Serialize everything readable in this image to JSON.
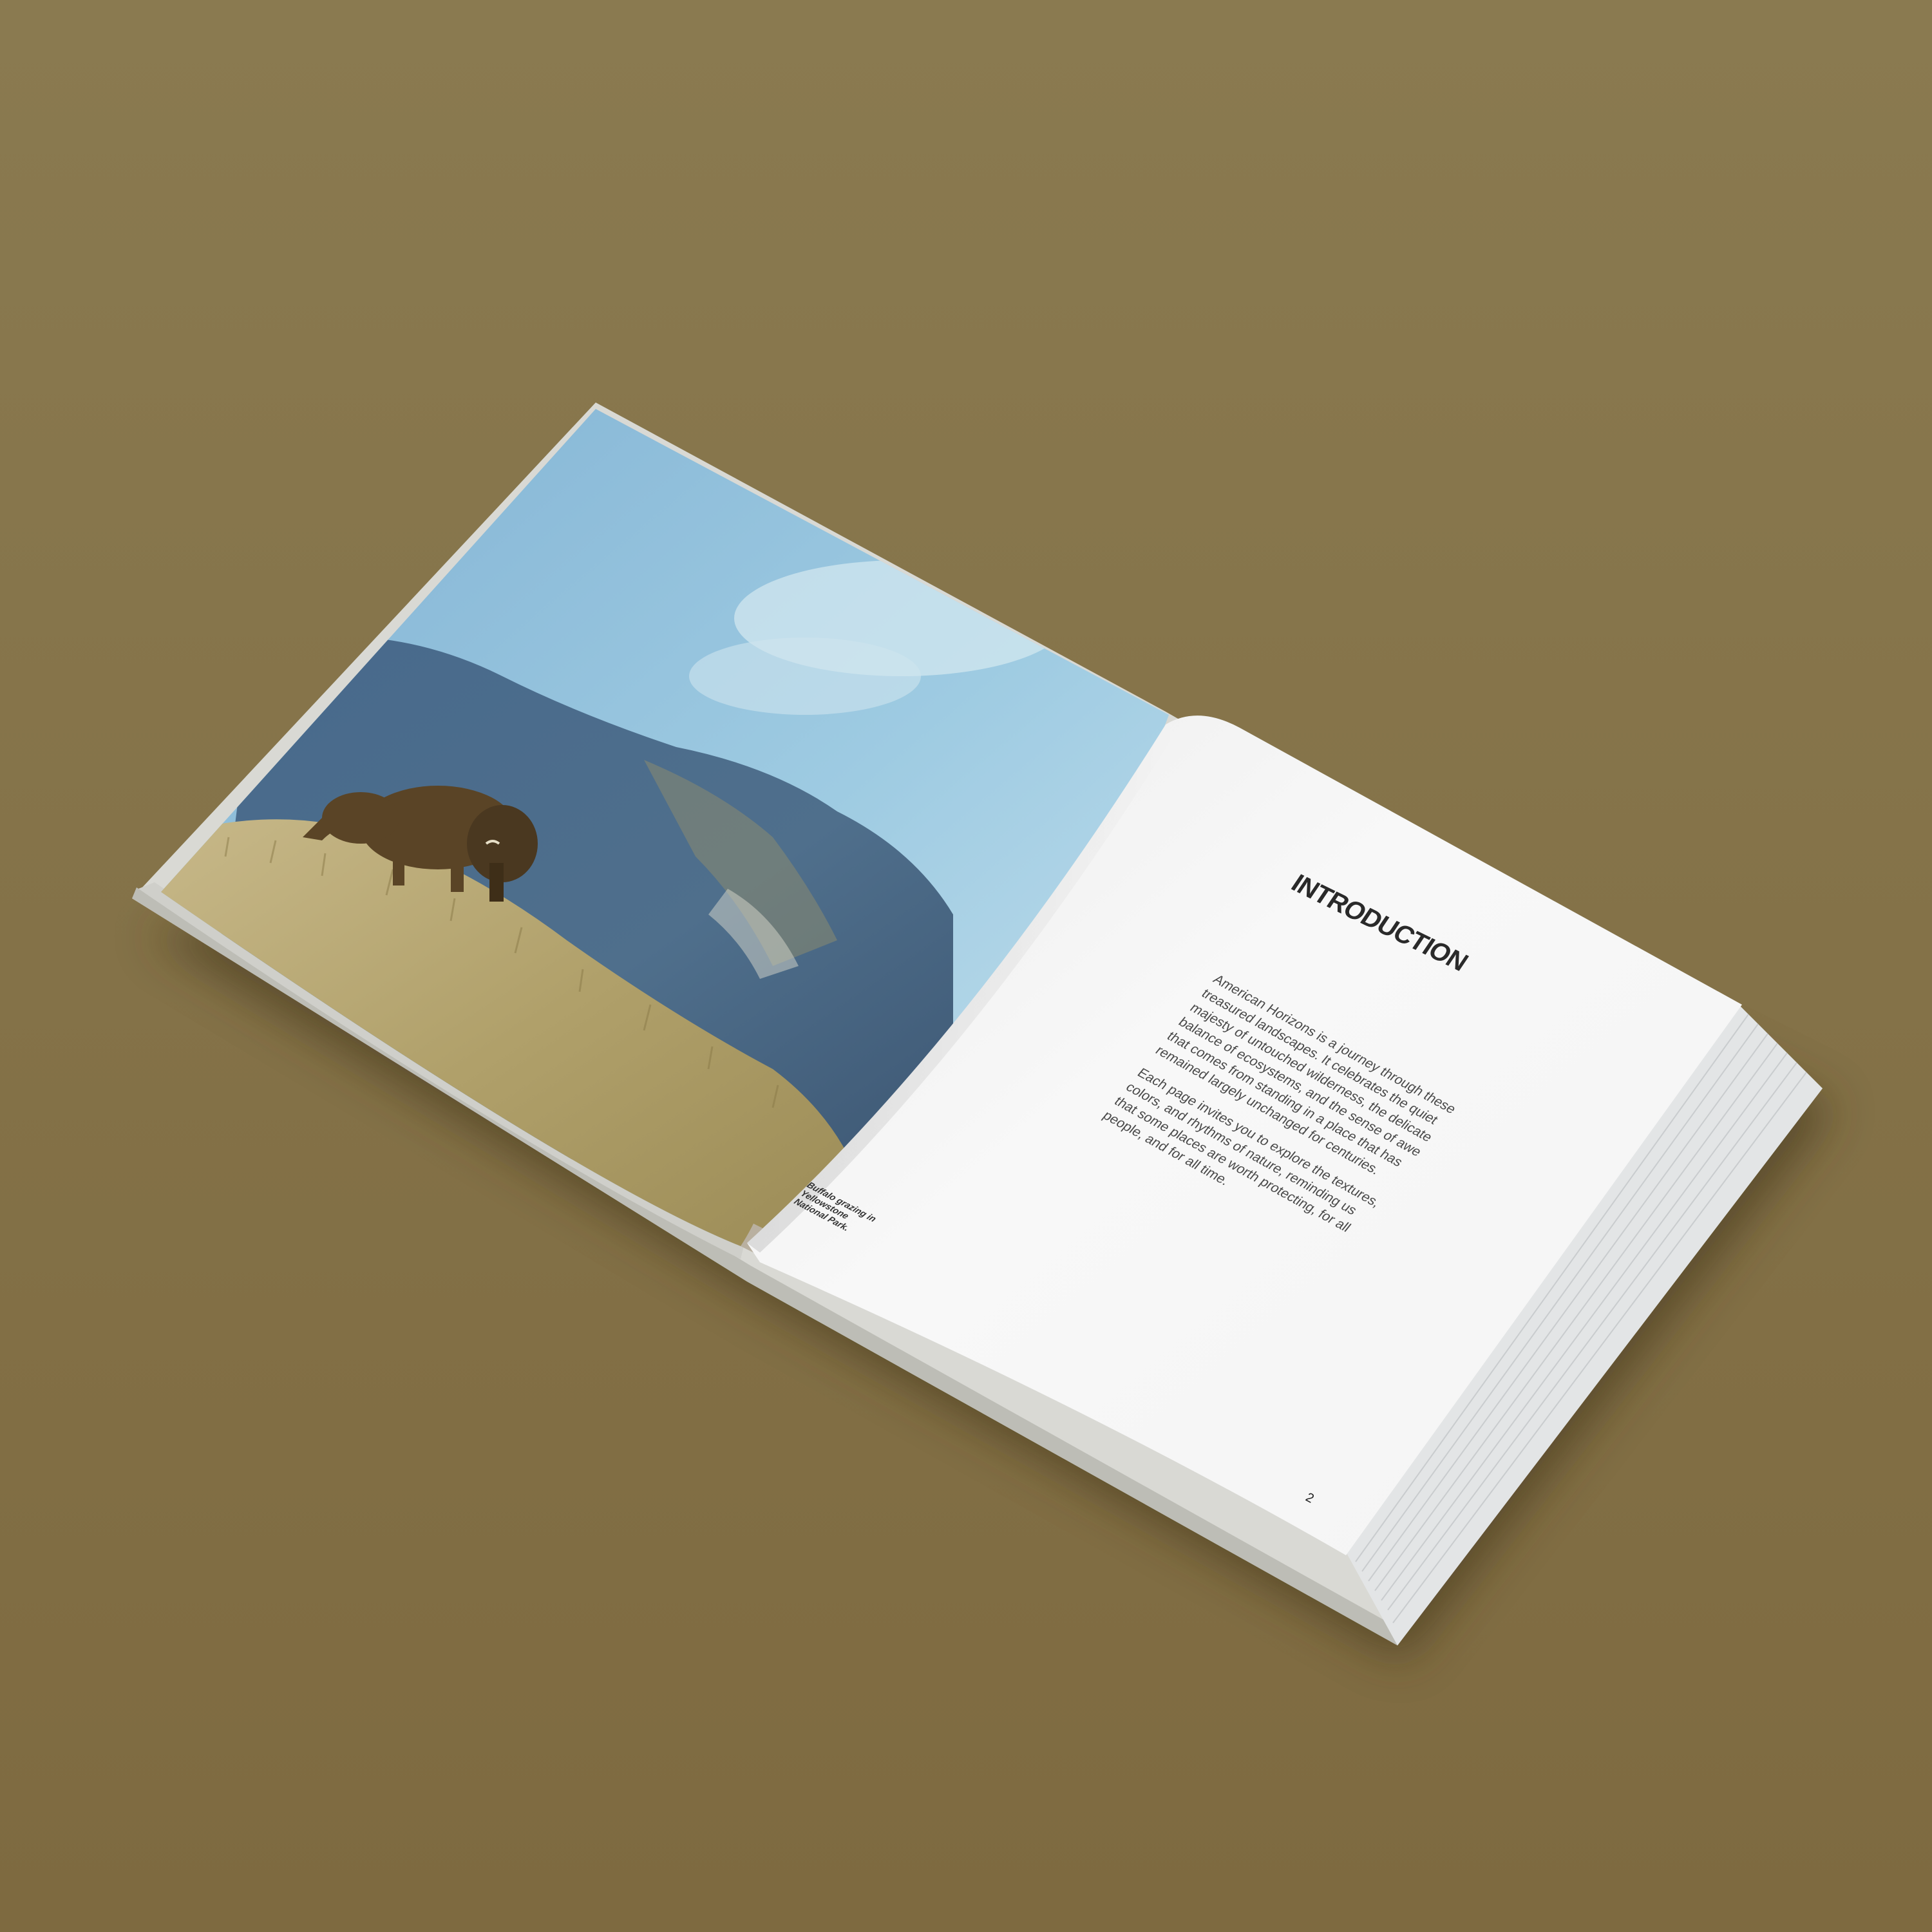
{
  "scene": {
    "background_color": "#857248",
    "subject": "open hardcover photo book"
  },
  "left_page": {
    "photo_caption": "Buffalo grazing in Yellowstone National Park."
  },
  "right_page": {
    "heading": "INTRODUCTION",
    "paragraphs": [
      "American Horizons is a journey through these treasured landscapes. It celebrates the quiet majesty of untouched wilderness, the delicate balance of ecosystems, and the sense of awe that comes from standing in a place that has remained largely unchanged for centuries.",
      "Each page invites you to explore the textures, colors, and rhythms of nature, reminding us that some places are worth protecting, for all people, and for all time."
    ],
    "page_number": "2"
  }
}
